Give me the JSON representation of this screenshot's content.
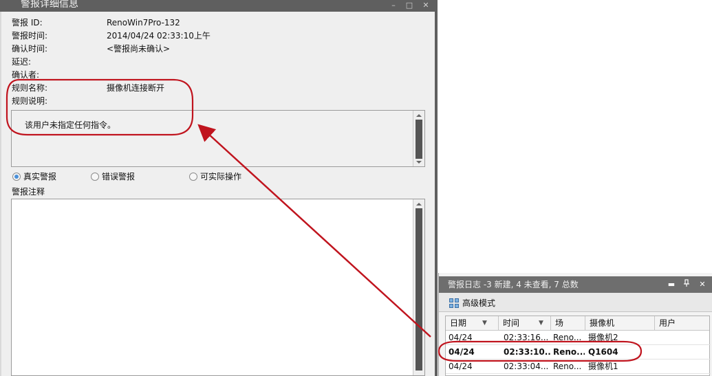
{
  "detail": {
    "title": "警报详细信息",
    "controls": {
      "minimize": "–",
      "maximize": "□",
      "close": "✕"
    },
    "fields": [
      {
        "label": "警报 ID:",
        "value": "RenoWin7Pro-132"
      },
      {
        "label": "警报时间:",
        "value": "2014/04/24 02:33:10上午"
      },
      {
        "label": "确认时间:",
        "value": "<警报尚未确认>"
      },
      {
        "label": "延迟:",
        "value": ""
      },
      {
        "label": "确认者:",
        "value": ""
      },
      {
        "label": "规则名称:",
        "value": "摄像机连接断开"
      },
      {
        "label": "规则说明:",
        "value": ""
      }
    ],
    "rule_description_text": "该用户未指定任何指令。",
    "radios": [
      {
        "label": "真实警报",
        "selected": true
      },
      {
        "label": "错误警报",
        "selected": false
      },
      {
        "label": "可实际操作",
        "selected": false
      }
    ],
    "notes_label": "警报注释",
    "notes_value": ""
  },
  "log": {
    "title": "警报日志 -3 新建, 4 未查看, 7 总数",
    "controls": {
      "float": "▬",
      "pin": "📌",
      "close": "✕"
    },
    "toolbar": {
      "advanced_mode": "高级模式",
      "icon": "advanced-mode-icon"
    },
    "columns": [
      {
        "label": "日期",
        "sort": "▼"
      },
      {
        "label": "时间",
        "sort": "▼"
      },
      {
        "label": "场",
        "sort": ""
      },
      {
        "label": "摄像机",
        "sort": ""
      },
      {
        "label": "用户",
        "sort": ""
      }
    ],
    "rows": [
      {
        "date": "04/24",
        "time": "02:33:16...",
        "site": "Reno...",
        "camera": "摄像机2",
        "user": "",
        "bold": false
      },
      {
        "date": "04/24",
        "time": "02:33:10...",
        "site": "Reno...",
        "camera": "Q1604",
        "user": "",
        "bold": true
      },
      {
        "date": "04/24",
        "time": "02:33:04...",
        "site": "Reno...",
        "camera": "摄像机1",
        "user": "",
        "bold": false
      }
    ]
  },
  "colors": {
    "annotation": "#c0141e",
    "titlebar": "#5f5f5f",
    "selected_radio": "#4a90d9"
  }
}
